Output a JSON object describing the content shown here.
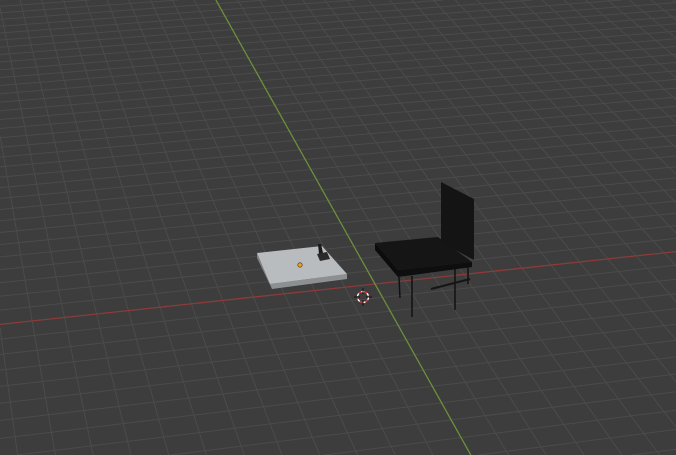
{
  "viewport": {
    "background": "#3d3d3d",
    "grid_color": "#4b4b4b",
    "x_axis_color": "#8c3b3b",
    "y_axis_color": "#6b8f3a"
  },
  "objects": [
    {
      "name": "table",
      "color": "#b9bcbe"
    },
    {
      "name": "chair",
      "color": "#111111"
    }
  ],
  "cursor": {
    "color_a": "#ffffff",
    "color_b": "#d23a3a"
  },
  "origin_marker": {
    "color": "#f0a020"
  }
}
